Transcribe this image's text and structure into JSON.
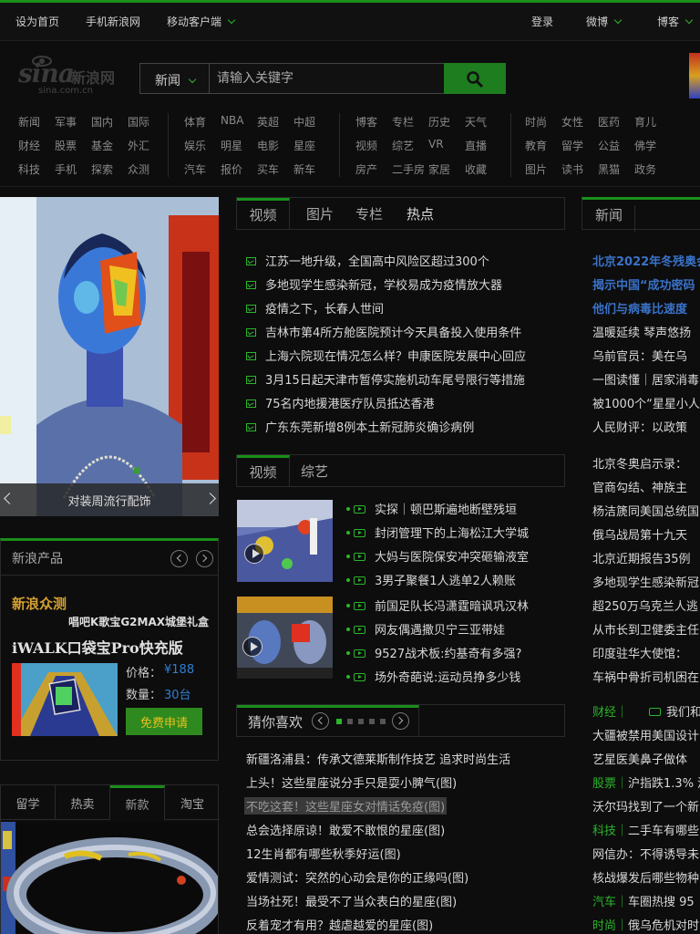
{
  "topbar": {
    "set_home": "设为首页",
    "mobile_sina": "手机新浪网",
    "mobile_client": "移动客户端",
    "login": "登录",
    "weibo": "微博",
    "blog": "博客"
  },
  "logo": {
    "text": "sina",
    "cn": "新浪网",
    "domain": "sina.com.cn"
  },
  "search": {
    "category": "新闻",
    "placeholder": "请输入关键字",
    "icon": "search-icon"
  },
  "nav": {
    "col1": [
      [
        "新闻",
        "军事",
        "国内",
        "国际"
      ],
      [
        "财经",
        "股票",
        "基金",
        "外汇"
      ],
      [
        "科技",
        "手机",
        "探索",
        "众测"
      ]
    ],
    "col2": [
      [
        "体育",
        "NBA",
        "英超",
        "中超"
      ],
      [
        "娱乐",
        "明星",
        "电影",
        "星座"
      ],
      [
        "汽车",
        "报价",
        "买车",
        "新车"
      ]
    ],
    "col3": [
      [
        "博客",
        "专栏",
        "历史",
        "天气"
      ],
      [
        "视频",
        "综艺",
        "VR",
        "直播"
      ],
      [
        "房产",
        "二手房",
        "家居",
        "收藏"
      ]
    ],
    "col4": [
      [
        "时尚",
        "女性",
        "医药",
        "育儿"
      ],
      [
        "教育",
        "留学",
        "公益",
        "佛学"
      ],
      [
        "图片",
        "读书",
        "黑猫",
        "政务"
      ]
    ]
  },
  "slideshow": {
    "caption": "对装周流行配饰"
  },
  "products": {
    "title": "新浪产品",
    "crowdtest": "新浪众测",
    "promo": "唱吧K歌宝G2MAX城堡礼盒",
    "product_name": "iWALK口袋宝Pro快充版",
    "price_label": "价格：",
    "price": "¥188",
    "qty_label": "数量：",
    "qty": "30台",
    "apply": "免费申请"
  },
  "bottom_tabs": [
    "留学",
    "热卖",
    "新款",
    "淘宝"
  ],
  "news_tabs": [
    "视频",
    "图片",
    "专栏",
    "热点"
  ],
  "news_list": [
    "江苏一地升级，全国高中风险区超过300个",
    "多地现学生感染新冠，学校易成为疫情放大器",
    "疫情之下，长春人世间",
    "吉林市第4所方舱医院预计今天具备投入使用条件",
    "上海六院现在情况怎么样？申康医院发展中心回应",
    "3月15日起天津市暂停实施机动车尾号限行等措施",
    "75名内地援港医疗队员抵达香港",
    "广东东莞新增8例本土新冠肺炎确诊病例"
  ],
  "video_tabs": [
    "视频",
    "综艺"
  ],
  "video_list": [
    "实探｜顿巴斯遍地断壁残垣",
    "封闭管理下的上海松江大学城",
    "大妈与医院保安冲突砸输液室",
    "3男子聚餐1人逃单2人赖账",
    "前国足队长冯潇霆暗讽巩汉林",
    "网友偶遇撒贝宁三亚带娃",
    "9527战术板:约基奇有多强?",
    "场外奇葩说:运动员挣多少钱"
  ],
  "guess": {
    "title": "猜你喜欢"
  },
  "guess_list": [
    "新疆洛浦县：传承文德莱斯制作技艺 追求时尚生活",
    "上头！这些星座说分手只是耍小脾气(图)",
    "不吃这套！这些星座女对情话免疫(图)",
    "总会选择原谅！敢爱不敢恨的星座(图)",
    "12生肖都有哪些秋季好运(图)",
    "爱情测试：突然的心动会是你的正缘吗(图)",
    "当场社死！最受不了当众表白的星座(图)",
    "反着宠才有用？越虐越爱的星座(图)"
  ],
  "right_tab": "新闻",
  "right_list": [
    "北京2022年冬残奥会",
    "揭示中国“成功密码",
    "他们与病毒比速度",
    "温暖延续 琴声悠扬",
    "乌前官员：美在乌",
    "一图读懂｜居家消毒",
    "被1000个“星星小人",
    "人民财评：以政策",
    "北京冬奥启示录：",
    "官商勾结、神族主",
    "杨洁篪同美国总统国",
    "俄乌战局第十九天",
    "北京近期报告35例",
    "多地现学生感染新冠",
    "超250万乌克兰人逃",
    "从市长到卫健委主任",
    "印度驻华大使馆：",
    "车祸中骨折司机困在",
    "财经｜",
    "我们和她",
    "大疆被禁用美国设计",
    "艺星医美鼻子做体",
    "股票｜沪指跌1.3% 港",
    "沃尔玛找到了一个新",
    "科技｜二手车有哪些",
    "网信办：不得诱导未",
    "核战爆发后哪些物种",
    "汽车｜车圈热搜 95",
    "时尚｜俄乌危机对时"
  ]
}
